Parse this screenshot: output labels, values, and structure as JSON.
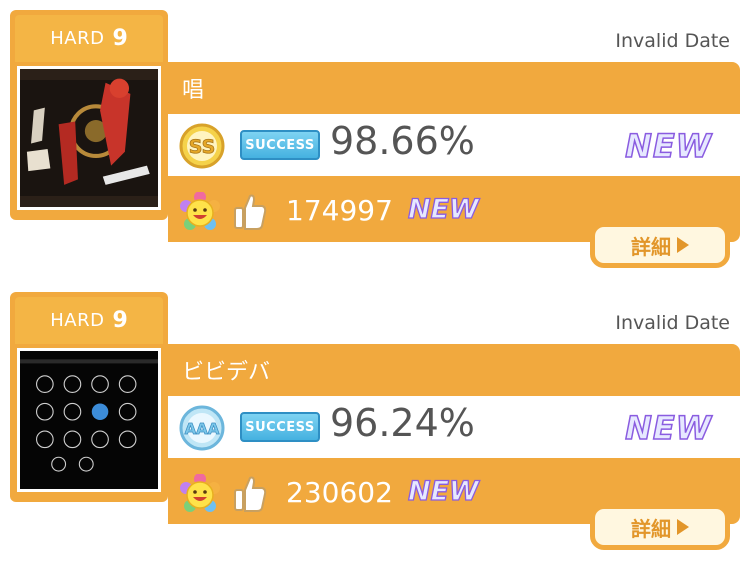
{
  "results": [
    {
      "difficulty": {
        "name": "HARD",
        "level": "9"
      },
      "date": "Invalid Date",
      "title": "唱",
      "rank": "SS",
      "status_badge": "SUCCESS",
      "accuracy": "98.66%",
      "accuracy_new": "NEW",
      "score": "174997",
      "score_new": "NEW",
      "detail_label": "詳細",
      "jacket_style": "dark-red"
    },
    {
      "difficulty": {
        "name": "HARD",
        "level": "9"
      },
      "date": "Invalid Date",
      "title": "ビビデバ",
      "rank": "AAA",
      "status_badge": "SUCCESS",
      "accuracy": "96.24%",
      "accuracy_new": "NEW",
      "score": "230602",
      "score_new": "NEW",
      "detail_label": "詳細",
      "jacket_style": "black-grid",
      "jacket_caption": "ビビデバ"
    }
  ],
  "colors": {
    "panel": "#f1a93e",
    "text_dark": "#555555",
    "success_badge": "#45b1e0",
    "new_accent": "#8a5ce0"
  }
}
